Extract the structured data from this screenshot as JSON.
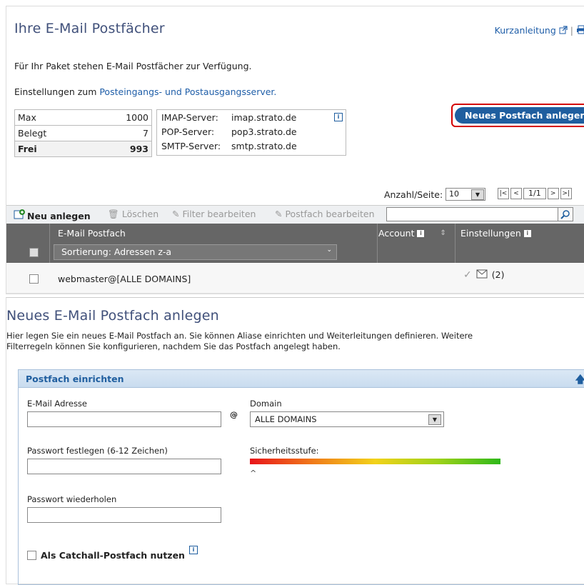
{
  "top": {
    "title": "Ihre E-Mail Postfächer",
    "help_link": "Kurzanleitung",
    "intro": "Für Ihr Paket stehen E-Mail Postfächer zur Verfügung.",
    "settings_prefix": "Einstellungen zum ",
    "settings_link": "Posteingangs- und Postausgangsserver.",
    "stats": [
      {
        "label": "Max",
        "value": "1000"
      },
      {
        "label": "Belegt",
        "value": "7"
      },
      {
        "label": "Frei",
        "value": "993"
      }
    ],
    "servers": [
      {
        "label": "IMAP-Server:",
        "value": "imap.strato.de"
      },
      {
        "label": "POP-Server:",
        "value": "pop3.strato.de"
      },
      {
        "label": "SMTP-Server:",
        "value": "smtp.strato.de"
      }
    ],
    "new_button": "Neues Postfach anlegen",
    "per_page_label": "Anzahl/Seite:",
    "per_page_value": "10",
    "page_info": "1/1",
    "toolbar": {
      "new": "Neu anlegen",
      "delete": "Löschen",
      "edit_filter": "Filter bearbeiten",
      "edit_mailbox": "Postfach bearbeiten"
    },
    "columns": {
      "mailbox": "E-Mail Postfach",
      "sort": "Sortierung: Adressen z-a",
      "account": "Account",
      "settings": "Einstellungen"
    },
    "rows": [
      {
        "mailbox": "webmaster@[ALLE DOMAINS]",
        "settings_count": "(2)"
      }
    ]
  },
  "form": {
    "title": "Neues E-Mail Postfach anlegen",
    "intro_line1": "Hier legen Sie ein neues E-Mail Postfach an. Sie können Aliase einrichten und Weiterleitungen definieren. Weitere",
    "intro_line2": "Filterregeln können Sie konfigurieren, nachdem Sie das Postfach angelegt haben.",
    "section": "Postfach einrichten",
    "email_label": "E-Mail Adresse",
    "at": "@",
    "domain_label": "Domain",
    "domain_value": "ALLE DOMAINS",
    "password_label": "Passwort festlegen (6-12 Zeichen)",
    "security_label": "Sicherheitsstufe:",
    "security_marker": "^",
    "repeat_label": "Passwort wiederholen",
    "catchall_label": "Als Catchall-Postfach nutzen",
    "security_level": 0.0
  },
  "colors": {
    "link": "#1f5ea8",
    "button": "#1f5e9f",
    "title": "#40507a",
    "highlight": "#d40000"
  }
}
